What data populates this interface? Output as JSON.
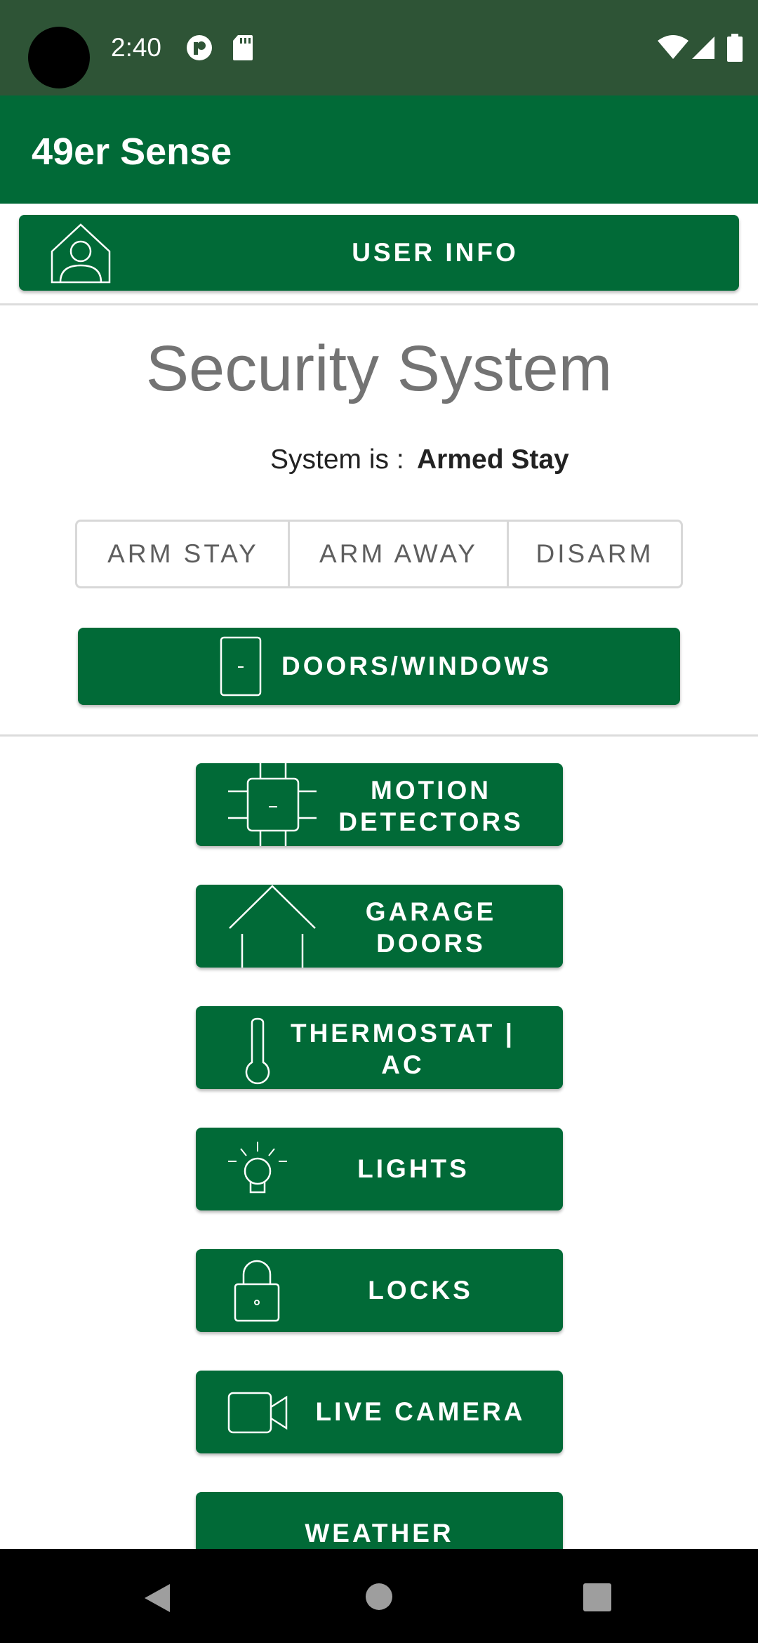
{
  "status_bar": {
    "time": "2:40"
  },
  "app_bar": {
    "title": "49er Sense"
  },
  "user_info_button": {
    "label": "USER INFO"
  },
  "security": {
    "title": "Security System",
    "status_label": "System is :",
    "status_value": "Armed Stay",
    "modes": [
      "ARM STAY",
      "ARM AWAY",
      "DISARM"
    ]
  },
  "doors_windows_button": {
    "label": "DOORS/WINDOWS"
  },
  "devices": [
    {
      "line1": "MOTION",
      "line2": "DETECTORS",
      "icon": "motion-sensor-icon"
    },
    {
      "line1": "GARAGE",
      "line2": "DOORS",
      "icon": "house-icon"
    },
    {
      "line1": "THERMOSTAT |",
      "line2": "AC",
      "icon": "thermometer-icon"
    },
    {
      "line1": "LIGHTS",
      "line2": "",
      "icon": "light-bulb-icon"
    },
    {
      "line1": "LOCKS",
      "line2": "",
      "icon": "lock-icon"
    },
    {
      "line1": "LIVE CAMERA",
      "line2": "",
      "icon": "video-camera-icon"
    },
    {
      "line1": "WEATHER",
      "line2": "",
      "icon": ""
    }
  ],
  "colors": {
    "status_bar": "#2e5436",
    "primary": "#016a37",
    "title_gray": "#737373"
  },
  "nav_bar": {
    "icons": [
      "back-icon",
      "home-icon",
      "recents-icon"
    ]
  }
}
